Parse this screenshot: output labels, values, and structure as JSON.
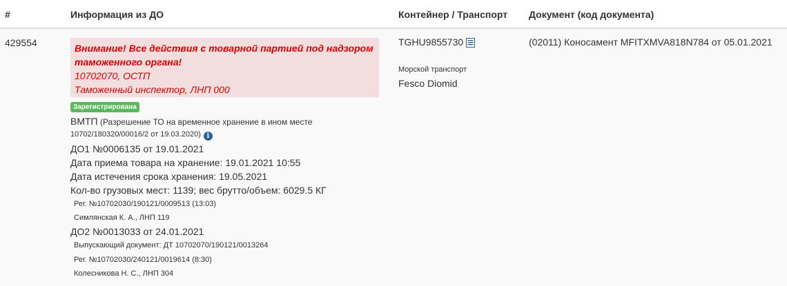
{
  "header": {
    "col_num": "#",
    "col_info": "Информация из ДО",
    "col_container": "Контейнер / Транспорт",
    "col_document": "Документ (код документа)"
  },
  "row": {
    "id": "429554",
    "alert": {
      "line1": "Внимание! Все действия с товарной партией под надзором",
      "line2": "таможенного органа!",
      "line3": "10702070, ОСТП",
      "line4": "Таможенный инспектор, ЛНП 000"
    },
    "status_badge": "Зарегистрирована",
    "vmtp_line1": "ВМТП (Разрешение ТО на временное хранение в ином месте",
    "vmtp_line2": "10702/180320/00016/2 от 19.03.2020)",
    "do1": "ДО1 №0006135 от 19.01.2021",
    "storage_date": "Дата приема товара на хранение: 19.01.2021 10:55",
    "expiry_date": "Дата истечения срока хранения: 19.05.2021",
    "cargo": "Кол-во грузовых мест: 1139; вес брутто/объем: 6029.5 КГ",
    "reg1": "Рег. №10702030/190121/0009513 (13:03)",
    "person1": "Симлянская К. А., ЛНП 119",
    "do2": "ДО2 №0013033 от 24.01.2021",
    "release_doc": "Выпускающий документ: ДТ 10702070/190121/0013264",
    "reg2": "Рег. №10702030/240121/0019614 (8:30)",
    "person2": "Колесникова Н. С., ЛНП 304",
    "container": "TGHU9855730",
    "transport_type": "Морской транспорт",
    "vessel": "Fesco Diomid",
    "document": "(02011) Коносамент MFITXMVA818N784 от 05.01.2021"
  },
  "icons": {
    "info": "info-circle-icon",
    "container_doc": "list-document-icon"
  },
  "colors": {
    "alert_bg": "#f2dede",
    "alert_text": "#e00000",
    "badge_bg": "#5cb85c",
    "info_icon": "#2a6496"
  }
}
